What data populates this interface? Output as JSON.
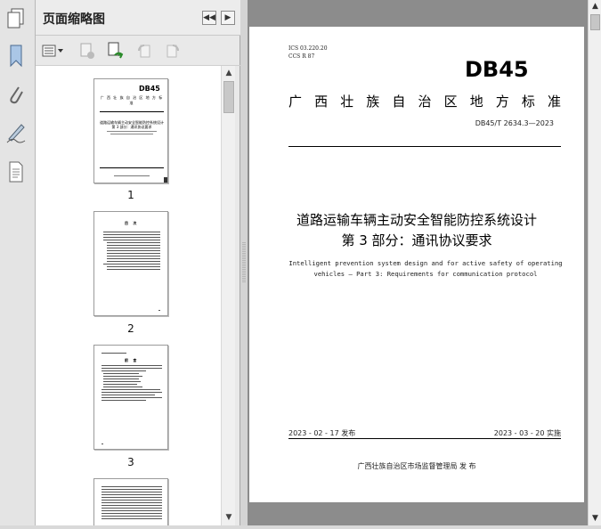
{
  "panel": {
    "title": "页面缩略图",
    "thumbnails": [
      {
        "number": "1"
      },
      {
        "number": "2"
      },
      {
        "number": "3"
      },
      {
        "number": ""
      }
    ],
    "thumb1_logo": "DB45",
    "thumb1_std": "广 西 壮 族 自 治 区 地 方 标 准",
    "thumb1_title": "道路运输车辆主动安全智能防控系统设计",
    "thumb1_sub": "第 3 部分：通讯协议要求",
    "thumb2_heading": "目  次",
    "thumb3_heading": "前  言"
  },
  "document": {
    "ics_line1": "ICS  03.220.20",
    "ics_line2": "CCS  R 87",
    "logo": "DB45",
    "standard_name": "广西壮族自治区地方标准",
    "standard_number": "DB45/T 2634.3—2023",
    "title_line1": "道路运输车辆主动安全智能防控系统设计",
    "title_line2": "第 3 部分：通讯协议要求",
    "english_line1": "Intelligent prevention system design and for active safety of operating",
    "english_line2": "vehicles — Part 3: Requirements for communication protocol",
    "publish_date": "2023 - 02 - 17 发布",
    "implement_date": "2023 - 03 - 20 实施",
    "issuer": "广西壮族自治区市场监督管理局    发  布"
  }
}
